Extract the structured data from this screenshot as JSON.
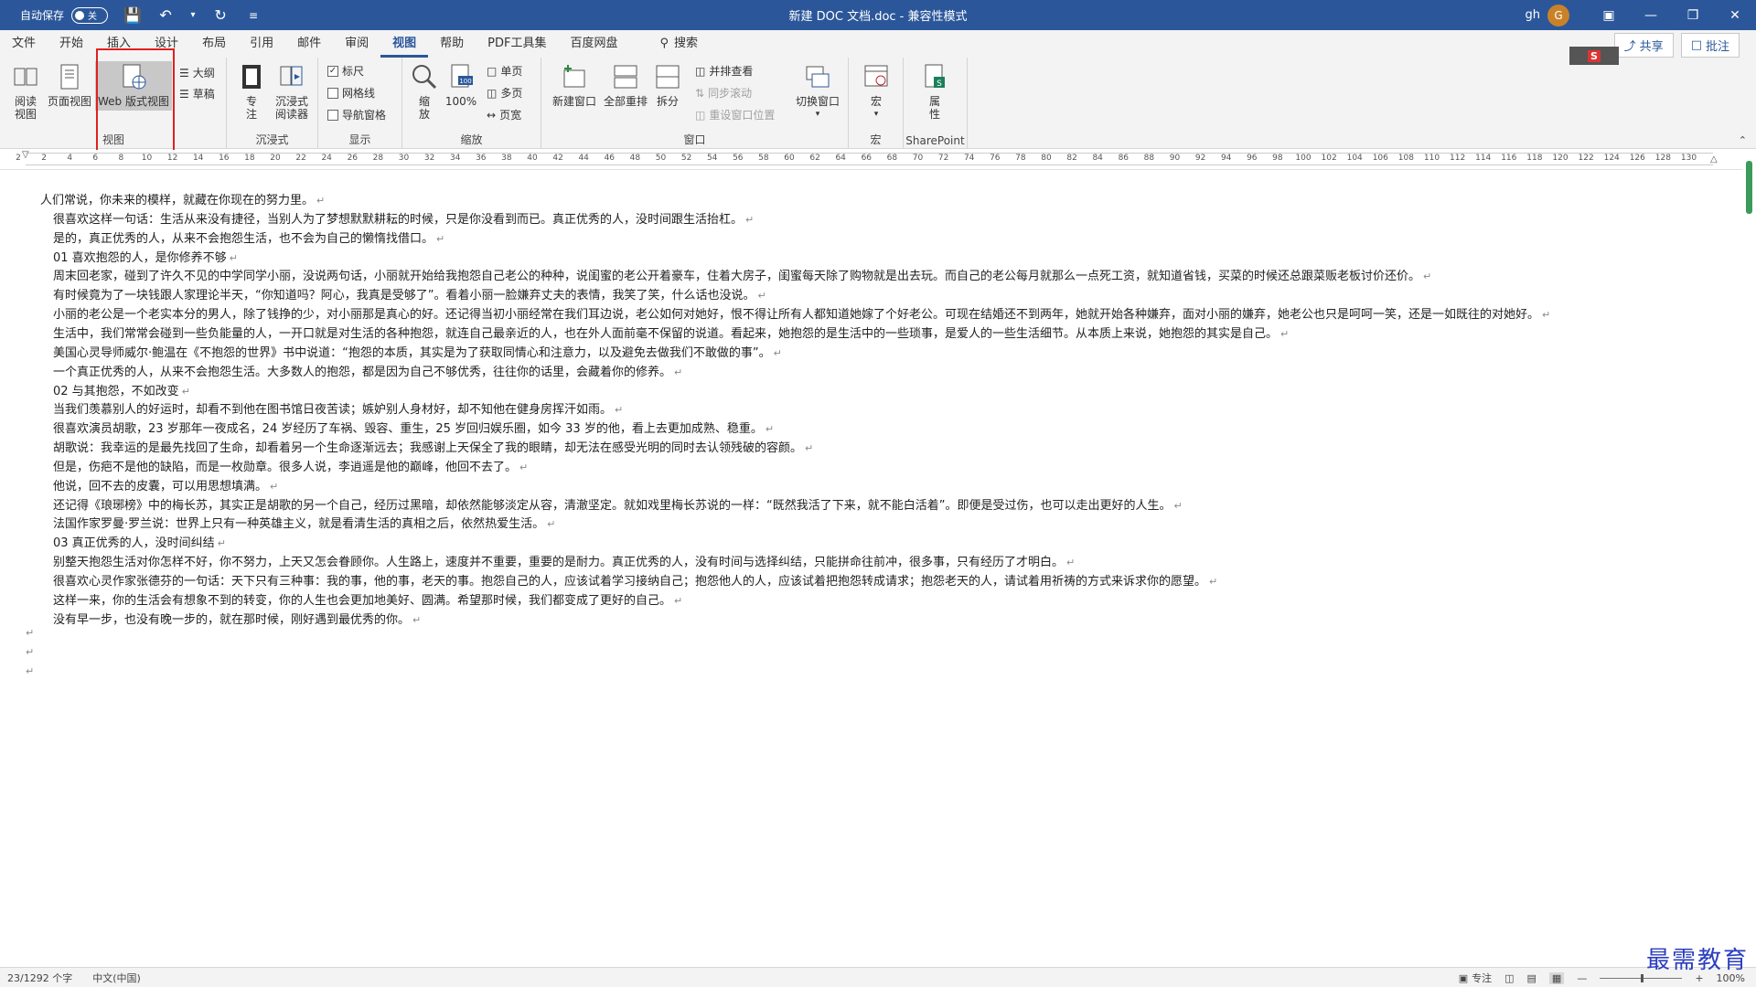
{
  "titlebar": {
    "autosave_label": "自动保存",
    "autosave_state": "关",
    "doc_title": "新建 DOC 文档.doc  -  兼容性模式",
    "user": "gh",
    "avatar_letter": "G"
  },
  "tabs": [
    "文件",
    "开始",
    "插入",
    "设计",
    "布局",
    "引用",
    "邮件",
    "审阅",
    "视图",
    "帮助",
    "PDF工具集",
    "百度网盘"
  ],
  "active_tab": "视图",
  "search_label": "搜索",
  "share_label": "共享",
  "comment_label": "批注",
  "ribbon": {
    "groups": {
      "view": "视图",
      "immersive": "沉浸式",
      "show": "显示",
      "zoom": "缩放",
      "window": "窗口",
      "macro": "宏",
      "sharepoint": "SharePoint"
    },
    "view": {
      "read_mode": "阅读\n视图",
      "read_mode_l1": "阅读",
      "read_mode_l2": "视图",
      "print_layout": "页面视图",
      "web_layout": "Web 版式视图",
      "outline": "大纲",
      "draft": "草稿"
    },
    "immersive": {
      "focus_l1": "专",
      "focus_l2": "注",
      "reader_l1": "沉浸式",
      "reader_l2": "阅读器"
    },
    "show": {
      "ruler": "标尺",
      "gridlines": "网格线",
      "nav_pane": "导航窗格"
    },
    "zoom": {
      "zoom_l1": "缩",
      "zoom_l2": "放",
      "hundred": "100%",
      "one_page": "单页",
      "multi_page": "多页",
      "page_width": "页宽"
    },
    "window": {
      "new_window": "新建窗口",
      "arrange_all": "全部重排",
      "split": "拆分",
      "side_by_side": "并排查看",
      "sync_scroll": "同步滚动",
      "reset_pos": "重设窗口位置",
      "switch_window": "切换窗口"
    },
    "macro": {
      "macro": "宏"
    },
    "sharepoint": {
      "props_l1": "属",
      "props_l2": "性"
    }
  },
  "ruler_numbers": [
    "2",
    "2",
    "4",
    "6",
    "8",
    "10",
    "12",
    "14",
    "16",
    "18",
    "20",
    "22",
    "24",
    "26",
    "28",
    "30",
    "32",
    "34",
    "36",
    "38",
    "40",
    "42",
    "44",
    "46",
    "48",
    "50",
    "52",
    "54",
    "56",
    "58",
    "60",
    "62",
    "64",
    "66",
    "68",
    "70",
    "72",
    "74",
    "76",
    "78",
    "80",
    "82",
    "84",
    "86",
    "88",
    "90",
    "92",
    "94",
    "96",
    "98",
    "100",
    "102",
    "104",
    "106",
    "108",
    "110",
    "112",
    "114",
    "116",
    "118",
    "120",
    "122",
    "124",
    "126",
    "128",
    "130"
  ],
  "paragraphs": [
    "人们常说，你未来的模样，就藏在你现在的努力里。",
    "很喜欢这样一句话：生活从来没有捷径，当别人为了梦想默默耕耘的时候，只是你没看到而已。真正优秀的人，没时间跟生活抬杠。",
    "是的，真正优秀的人，从来不会抱怨生活，也不会为自己的懒惰找借口。",
    "01 喜欢抱怨的人，是你修养不够",
    "周末回老家，碰到了许久不见的中学同学小丽，没说两句话，小丽就开始给我抱怨自己老公的种种，说闺蜜的老公开着豪车，住着大房子，闺蜜每天除了购物就是出去玩。而自己的老公每月就那么一点死工资，就知道省钱，买菜的时候还总跟菜贩老板讨价还价。",
    "有时候竟为了一块钱跟人家理论半天，“你知道吗？阿心，我真是受够了”。看着小丽一脸嫌弃丈夫的表情，我笑了笑，什么话也没说。",
    "小丽的老公是一个老实本分的男人，除了钱挣的少，对小丽那是真心的好。还记得当初小丽经常在我们耳边说，老公如何对她好，恨不得让所有人都知道她嫁了个好老公。可现在结婚还不到两年，她就开始各种嫌弃，面对小丽的嫌弃，她老公也只是呵呵一笑，还是一如既往的对她好。",
    "生活中，我们常常会碰到一些负能量的人，一开口就是对生活的各种抱怨，就连自己最亲近的人，也在外人面前毫不保留的说道。看起来，她抱怨的是生活中的一些琐事，是爱人的一些生活细节。从本质上来说，她抱怨的其实是自己。",
    "美国心灵导师威尔·鲍温在《不抱怨的世界》书中说道：“抱怨的本质，其实是为了获取同情心和注意力，以及避免去做我们不敢做的事”。",
    "一个真正优秀的人，从来不会抱怨生活。大多数人的抱怨，都是因为自己不够优秀，往往你的话里，会藏着你的修养。",
    "02 与其抱怨，不如改变",
    "当我们羡慕别人的好运时，却看不到他在图书馆日夜苦读；嫉妒别人身材好，却不知他在健身房挥汗如雨。",
    "很喜欢演员胡歌，23 岁那年一夜成名，24 岁经历了车祸、毁容、重生，25 岁回归娱乐圈，如今 33 岁的他，看上去更加成熟、稳重。",
    "胡歌说：我幸运的是最先找回了生命，却看着另一个生命逐渐远去；我感谢上天保全了我的眼睛，却无法在感受光明的同时去认领残破的容颜。",
    "但是，伤疤不是他的缺陷，而是一枚勋章。很多人说，李逍遥是他的巅峰，他回不去了。",
    "他说，回不去的皮囊，可以用思想填满。",
    "还记得《琅琊榜》中的梅长苏，其实正是胡歌的另一个自己，经历过黑暗，却依然能够淡定从容，清澈坚定。就如戏里梅长苏说的一样：“既然我活了下来，就不能白活着”。即便是受过伤，也可以走出更好的人生。",
    "法国作家罗曼·罗兰说：世界上只有一种英雄主义，就是看清生活的真相之后，依然热爱生活。",
    "03 真正优秀的人，没时间纠结",
    "别整天抱怨生活对你怎样不好，你不努力，上天又怎会眷顾你。人生路上，速度并不重要，重要的是耐力。真正优秀的人，没有时间与选择纠结，只能拼命往前冲，很多事，只有经历了才明白。",
    "很喜欢心灵作家张德芬的一句话：天下只有三种事：我的事，他的事，老天的事。抱怨自己的人，应该试着学习接纳自己；抱怨他人的人，应该试着把抱怨转成请求；抱怨老天的人，请试着用祈祷的方式来诉求你的愿望。",
    "这样一来，你的生活会有想象不到的转变，你的人生也会更加地美好、圆满。希望那时候，我们都变成了更好的自己。",
    "没有早一步，也没有晚一步的，就在那时候，刚好遇到最优秀的你。"
  ],
  "pilcrow": "↵",
  "statusbar": {
    "words": "23/1292 个字",
    "language": "中文(中国)",
    "focus": "专注",
    "zoom": "100%"
  },
  "watermark": "最需教育",
  "colors": {
    "accent": "#2b579a",
    "highlight": "#e02020",
    "scroll_thumb": "#3a9b5a"
  }
}
